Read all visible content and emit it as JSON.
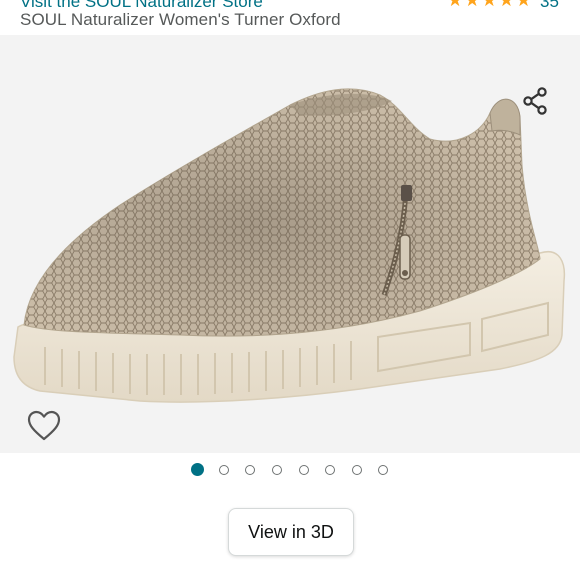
{
  "header": {
    "store_link": "Visit the SOUL Naturalizer Store",
    "rating_stars": "★★★★★",
    "rating_count": "35",
    "product_title": "SOUL Naturalizer Women's Turner Oxford"
  },
  "gallery": {
    "image_count": 8,
    "active_index": 0,
    "share_icon": "share-icon",
    "wishlist_icon": "heart-outline-icon"
  },
  "view_3d": {
    "label": "View in 3D"
  },
  "colors": {
    "link": "#007185",
    "title": "#565959",
    "star": "#ffa41c",
    "image_bg": "#f3f3f3"
  }
}
